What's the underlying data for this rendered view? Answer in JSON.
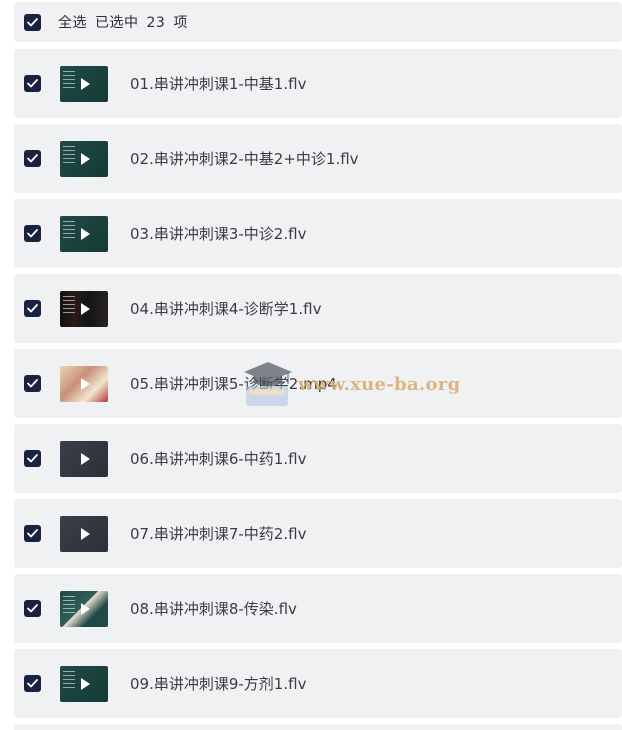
{
  "header": {
    "select_all_label": "全选",
    "selected_prefix": "已选中",
    "selected_count": "23",
    "selected_suffix": "项"
  },
  "files": [
    {
      "name": "01.串讲冲刺课1-中基1.flv",
      "thumb": "lecture-dark-teal"
    },
    {
      "name": "02.串讲冲刺课2-中基2+中诊1.flv",
      "thumb": "lecture-dark-teal"
    },
    {
      "name": "03.串讲冲刺课3-中诊2.flv",
      "thumb": "lecture-dark-teal"
    },
    {
      "name": "04.串讲冲刺课4-诊断学1.flv",
      "thumb": "lecture-black-images"
    },
    {
      "name": "05.串讲冲刺课5-诊断学2.mp4",
      "thumb": "person-photo"
    },
    {
      "name": "06.串讲冲刺课6-中药1.flv",
      "thumb": "slate-gray"
    },
    {
      "name": "07.串讲冲刺课7-中药2.flv",
      "thumb": "slate-gray"
    },
    {
      "name": "08.串讲冲刺课8-传染.flv",
      "thumb": "lecture-teal-images"
    },
    {
      "name": "09.串讲冲刺课9-方剂1.flv",
      "thumb": "lecture-dark-teal"
    }
  ],
  "watermark": {
    "text": "www.xue-ba.org"
  },
  "colors": {
    "checkbox": "#1a2240",
    "row_bg": "#f0f1f3",
    "text": "#3a3d44",
    "watermark": "#d6ac6e"
  }
}
